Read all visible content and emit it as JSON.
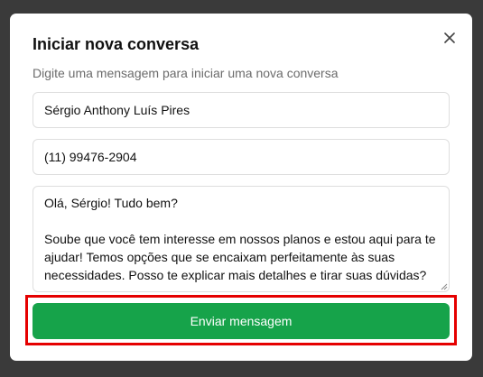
{
  "dialog": {
    "title": "Iniciar nova conversa",
    "subtitle": "Digite uma mensagem para iniciar uma nova conversa",
    "close_icon": "close-icon",
    "name_value": "Sérgio Anthony Luís Pires",
    "phone_value": "(11) 99476-2904",
    "message_value": "Olá, Sérgio! Tudo bem?\n\nSoube que você tem interesse em nossos planos e estou aqui para te ajudar! Temos opções que se encaixam perfeitamente às suas necessidades. Posso te explicar mais detalhes e tirar suas dúvidas?",
    "send_label": "Enviar mensagem"
  },
  "colors": {
    "backdrop": "#3a3a3a",
    "primary_button": "#16a34a",
    "highlight_border": "#e50000"
  }
}
